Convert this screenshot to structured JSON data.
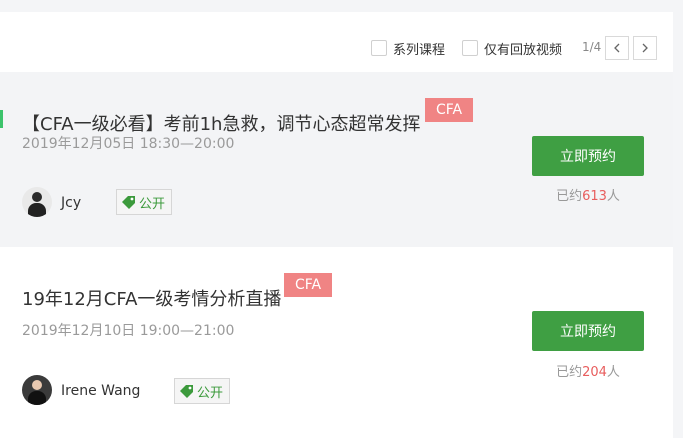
{
  "filters": {
    "series_label": "系列课程",
    "replay_label": "仅有回放视频"
  },
  "pager": {
    "text": "1/4"
  },
  "courses": [
    {
      "title": "【CFA一级必看】考前1h急救，调节心态超常发挥",
      "tag": "CFA",
      "time": "2019年12月05日 18:30—20:00",
      "teacher": "Jcy",
      "public_label": "公开",
      "button_label": "立即预约",
      "count_prefix": "已约",
      "count_num": "613",
      "count_suffix": "人"
    },
    {
      "title": "19年12月CFA一级考情分析直播",
      "tag": "CFA",
      "time": "2019年12月10日 19:00—21:00",
      "teacher": "Irene Wang",
      "public_label": "公开",
      "button_label": "立即预约",
      "count_prefix": "已约",
      "count_num": "204",
      "count_suffix": "人"
    }
  ],
  "colors": {
    "tag_bg": "#f08484",
    "button_bg": "#3f9f43",
    "accent": "#3cc36b",
    "count_num": "#e85d5d"
  },
  "icons": {
    "prev": "chevron-left-icon",
    "next": "chevron-right-icon",
    "tag": "price-tag-icon"
  }
}
